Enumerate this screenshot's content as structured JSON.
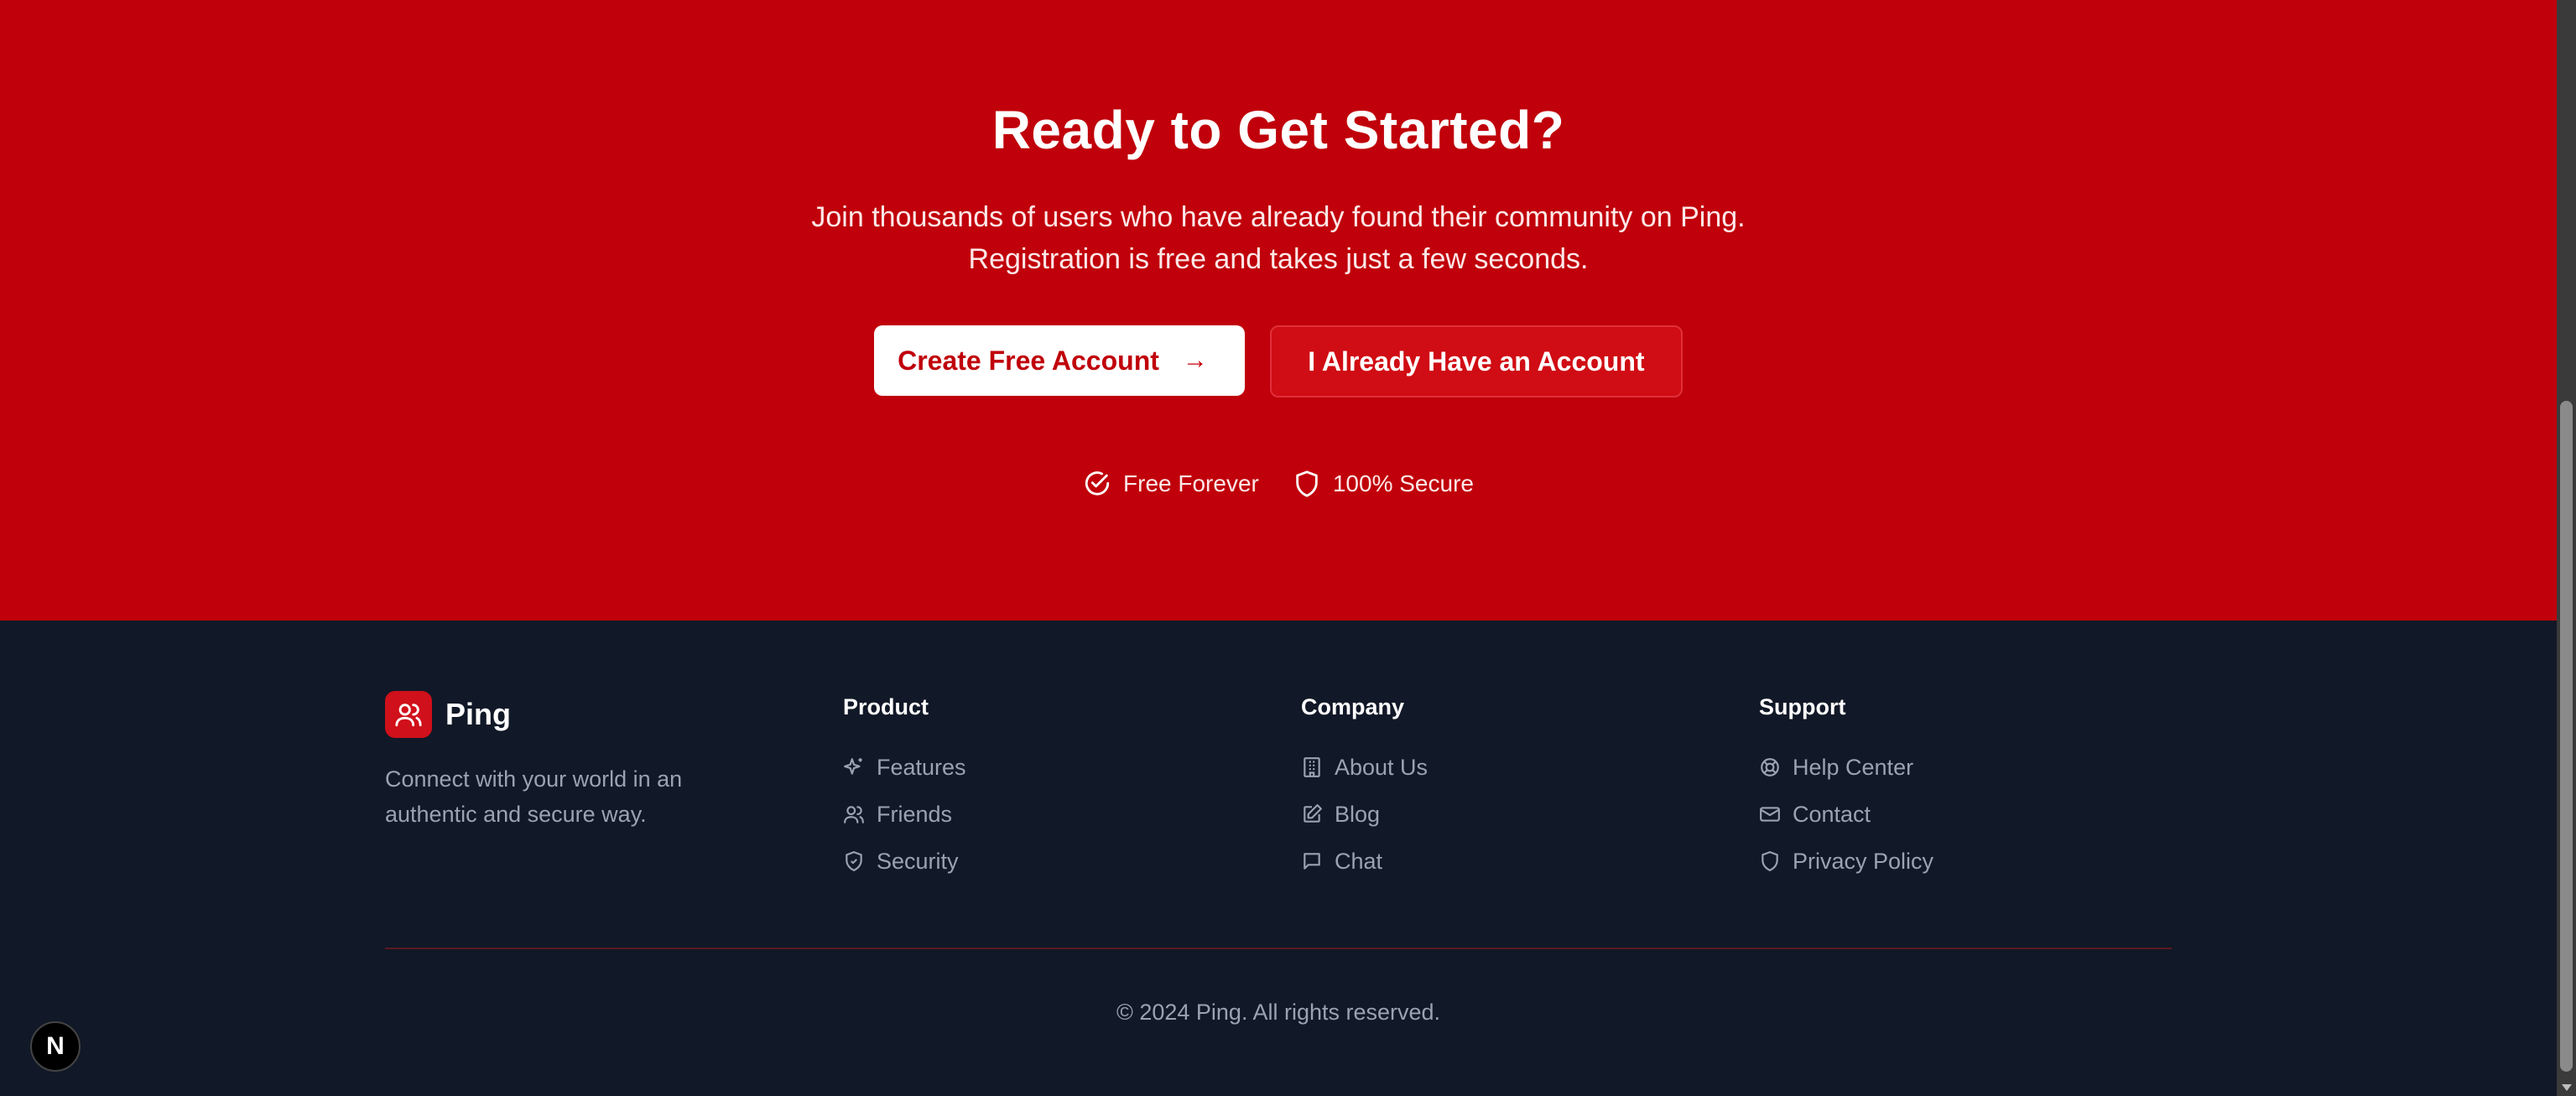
{
  "cta": {
    "title": "Ready to Get Started?",
    "subtitle_line1": "Join thousands of users who have already found their community on Ping.",
    "subtitle_line2": "Registration is free and takes just a few seconds.",
    "primary_button": "Create Free Account",
    "primary_arrow": "→",
    "secondary_button": "I Already Have an Account",
    "badges": [
      {
        "icon": "check-circle-icon",
        "label": "Free Forever"
      },
      {
        "icon": "shield-icon",
        "label": "100% Secure"
      }
    ]
  },
  "footer": {
    "brand": "Ping",
    "tagline": "Connect with your world in an authentic and secure way.",
    "columns": [
      {
        "title": "Product",
        "items": [
          {
            "icon": "sparkles-icon",
            "label": "Features"
          },
          {
            "icon": "users-icon",
            "label": "Friends"
          },
          {
            "icon": "shield-check-icon",
            "label": "Security"
          }
        ]
      },
      {
        "title": "Company",
        "items": [
          {
            "icon": "building-icon",
            "label": "About Us"
          },
          {
            "icon": "edit-icon",
            "label": "Blog"
          },
          {
            "icon": "message-icon",
            "label": "Chat"
          }
        ]
      },
      {
        "title": "Support",
        "items": [
          {
            "icon": "lifebuoy-icon",
            "label": "Help Center"
          },
          {
            "icon": "mail-icon",
            "label": "Contact"
          },
          {
            "icon": "shield-icon",
            "label": "Privacy Policy"
          }
        ]
      }
    ],
    "copyright": "© 2024 Ping. All rights reserved."
  },
  "dev_badge": "N",
  "colors": {
    "accent": "#c0000a",
    "footer_bg": "#111827",
    "muted_text": "#9aa3b2"
  }
}
